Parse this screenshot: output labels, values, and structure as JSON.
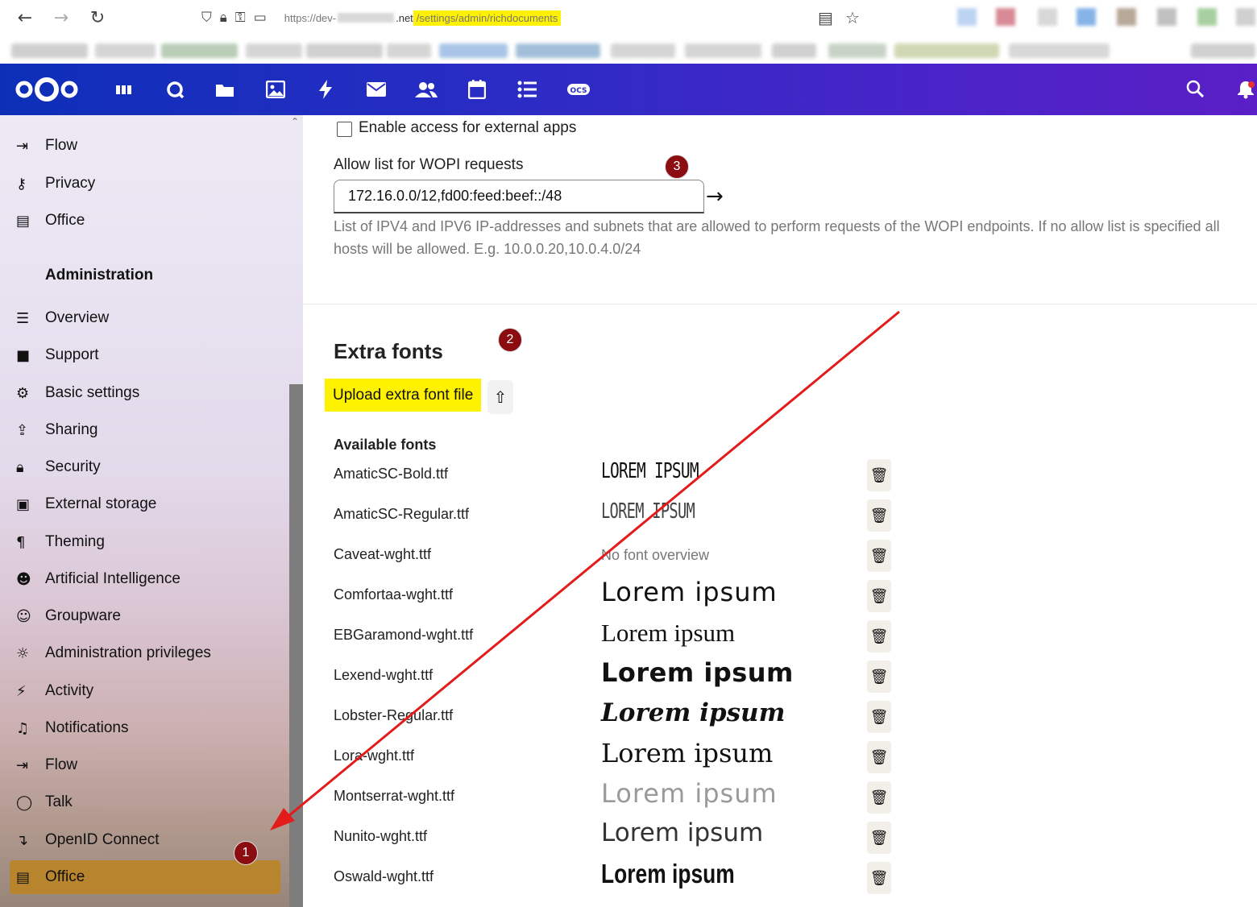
{
  "browser": {
    "back_icon": "←",
    "forward_icon": "→",
    "reload_icon": "↻",
    "url_prefix": "https://dev-",
    "url_domain_end": ".net",
    "url_path": "/settings/admin/richdocuments"
  },
  "header": {
    "apps": [
      "dashboard-icon",
      "talk-icon",
      "files-icon",
      "photos-icon",
      "activity-icon",
      "mail-icon",
      "contacts-icon",
      "calendar-icon",
      "tasks-icon",
      "ocs-icon"
    ]
  },
  "sidebar": {
    "personal_items": [
      {
        "label": "Flow",
        "icon": "⇥"
      },
      {
        "label": "Privacy",
        "icon": "⚷"
      },
      {
        "label": "Office",
        "icon": "▤"
      }
    ],
    "admin_heading": "Administration",
    "admin_items": [
      {
        "label": "Overview",
        "icon": "☰"
      },
      {
        "label": "Support",
        "icon": "■"
      },
      {
        "label": "Basic settings",
        "icon": "⚙"
      },
      {
        "label": "Sharing",
        "icon": "⇪"
      },
      {
        "label": "Security",
        "icon": "🔒"
      },
      {
        "label": "External storage",
        "icon": "▣"
      },
      {
        "label": "Theming",
        "icon": "🖌"
      },
      {
        "label": "Artificial Intelligence",
        "icon": "☻"
      },
      {
        "label": "Groupware",
        "icon": "☺"
      },
      {
        "label": "Administration privileges",
        "icon": "☼"
      },
      {
        "label": "Activity",
        "icon": "⚡"
      },
      {
        "label": "Notifications",
        "icon": "🔔"
      },
      {
        "label": "Flow",
        "icon": "⇥"
      },
      {
        "label": "Talk",
        "icon": "◯"
      },
      {
        "label": "OpenID Connect",
        "icon": "↴"
      },
      {
        "label": "Office",
        "icon": "▤"
      }
    ],
    "active_item": "Office"
  },
  "main": {
    "external_apps_label": "Enable access for external apps",
    "allow_list_label": "Allow list for WOPI requests",
    "allow_list_value": "172.16.0.0/12,fd00:feed:beef::/48",
    "allow_list_hint": "List of IPV4 and IPV6 IP-addresses and subnets that are allowed to perform requests of the WOPI endpoints. If no allow list is specified all hosts will be allowed. E.g. 10.0.0.20,10.0.4.0/24",
    "extra_fonts_title": "Extra fonts",
    "upload_label": "Upload extra font file",
    "available_fonts_title": "Available fonts",
    "fonts": [
      {
        "name": "AmaticSC-Bold.ttf",
        "preview": "LOREM IPSUM"
      },
      {
        "name": "AmaticSC-Regular.ttf",
        "preview": "LOREM IPSUM"
      },
      {
        "name": "Caveat-wght.ttf",
        "preview": "No font overview"
      },
      {
        "name": "Comfortaa-wght.ttf",
        "preview": "Lorem ipsum"
      },
      {
        "name": "EBGaramond-wght.ttf",
        "preview": "Lorem ipsum"
      },
      {
        "name": "Lexend-wght.ttf",
        "preview": "Lorem ipsum"
      },
      {
        "name": "Lobster-Regular.ttf",
        "preview": "Lorem ipsum"
      },
      {
        "name": "Lora-wght.ttf",
        "preview": "Lorem ipsum"
      },
      {
        "name": "Montserrat-wght.ttf",
        "preview": "Lorem ipsum"
      },
      {
        "name": "Nunito-wght.ttf",
        "preview": "Lorem ipsum"
      },
      {
        "name": "Oswald-wght.ttf",
        "preview": "Lorem ipsum"
      }
    ]
  },
  "annotations": {
    "badge1": "1",
    "badge2": "2",
    "badge3": "3",
    "arrow_color": "#e31b1b",
    "highlight_color": "#fff200"
  }
}
